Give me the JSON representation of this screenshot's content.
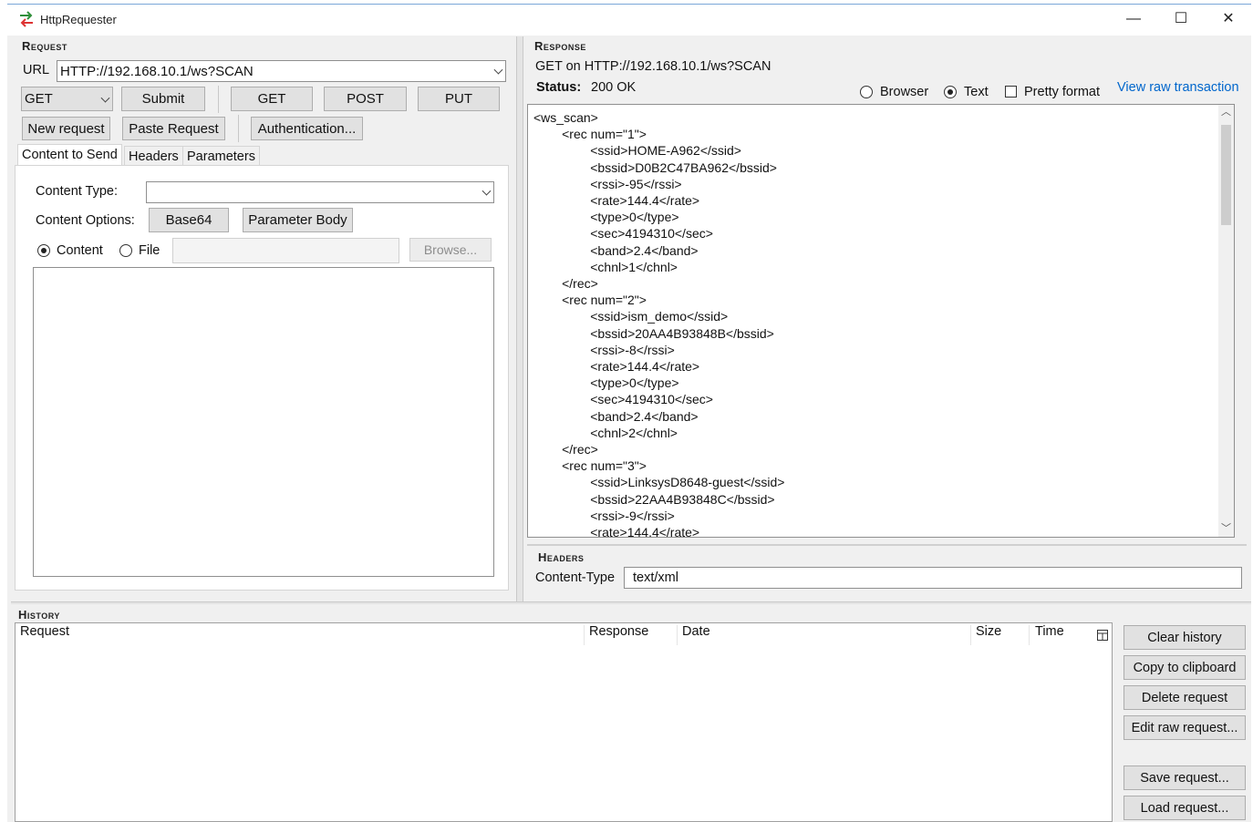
{
  "window": {
    "title": "HttpRequester",
    "minimize": "—",
    "maximize": "☐",
    "close": "✕"
  },
  "request": {
    "heading": "Request",
    "url_label": "URL",
    "url_value": "HTTP://192.168.10.1/ws?SCAN",
    "method_value": "GET",
    "submit": "Submit",
    "get": "GET",
    "post": "POST",
    "put": "PUT",
    "new_request": "New request",
    "paste_request": "Paste Request",
    "authentication": "Authentication...",
    "tabs": [
      "Content to Send",
      "Headers",
      "Parameters"
    ],
    "content_type_label": "Content Type:",
    "content_type_value": "",
    "content_options_label": "Content Options:",
    "base64": "Base64",
    "parameter_body": "Parameter Body",
    "radio_content": "Content",
    "radio_file": "File",
    "browse": "Browse..."
  },
  "response": {
    "heading": "Response",
    "summary": "GET on HTTP://192.168.10.1/ws?SCAN",
    "status_label": "Status:",
    "status_value": "200 OK",
    "view_browser": "Browser",
    "view_text": "Text",
    "pretty_format": "Pretty format",
    "view_raw": "View raw transaction",
    "body_lines": [
      "<ws_scan>",
      "        <rec num=\"1\">",
      "                <ssid>HOME-A962</ssid>",
      "                <bssid>D0B2C47BA962</bssid>",
      "                <rssi>-95</rssi>",
      "                <rate>144.4</rate>",
      "                <type>0</type>",
      "                <sec>4194310</sec>",
      "                <band>2.4</band>",
      "                <chnl>1</chnl>",
      "        </rec>",
      "        <rec num=\"2\">",
      "                <ssid>ism_demo</ssid>",
      "                <bssid>20AA4B93848B</bssid>",
      "                <rssi>-8</rssi>",
      "                <rate>144.4</rate>",
      "                <type>0</type>",
      "                <sec>4194310</sec>",
      "                <band>2.4</band>",
      "                <chnl>2</chnl>",
      "        </rec>",
      "        <rec num=\"3\">",
      "                <ssid>LinksysD8648-guest</ssid>",
      "                <bssid>22AA4B93848C</bssid>",
      "                <rssi>-9</rssi>",
      "                <rate>144.4</rate>"
    ],
    "headers_heading": "Headers",
    "header_name": "Content-Type",
    "header_value": "text/xml"
  },
  "history": {
    "heading": "History",
    "columns": [
      "Request",
      "Response",
      "Date",
      "Size",
      "Time"
    ],
    "clear_history": "Clear history",
    "copy_clipboard": "Copy to clipboard",
    "delete_request": "Delete request",
    "edit_raw": "Edit raw request...",
    "save_request": "Save request...",
    "load_request": "Load request..."
  }
}
